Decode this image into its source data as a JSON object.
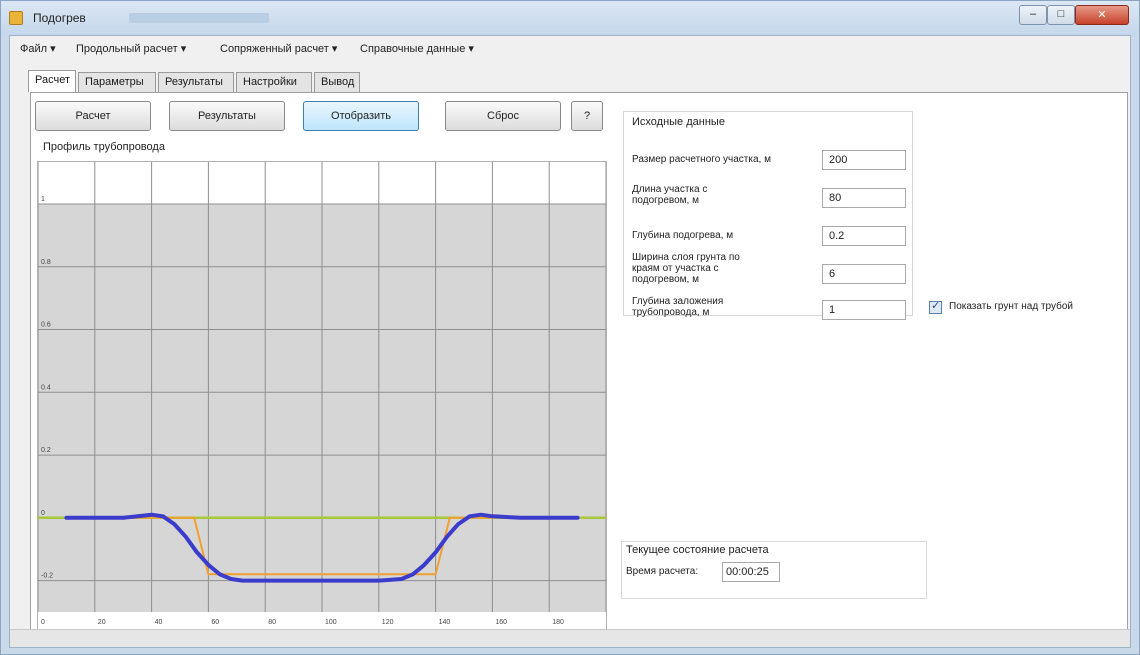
{
  "window": {
    "title": "Подогрев",
    "controls": {
      "minimize": "–",
      "maximize": "□",
      "close": "✕"
    }
  },
  "menu": [
    "Файл ▾",
    "Продольный расчет ▾",
    "Сопряженный расчет ▾",
    "Справочные данные ▾"
  ],
  "tabs": [
    "Расчет",
    "Параметры",
    "Результаты",
    "Настройки",
    "Вывод"
  ],
  "active_tab": 0,
  "toolbar": {
    "calc": "Расчет",
    "results": "Результаты",
    "show": "Отобразить",
    "reset": "Сброс",
    "help": "?"
  },
  "chart_title": "Профиль трубопровода",
  "input_group": {
    "title": "Исходные данные",
    "fields": [
      {
        "label": "Размер расчетного участка, м",
        "value": "200"
      },
      {
        "label": "Длина участка с подогревом, м",
        "value": "80"
      },
      {
        "label": "Глубина подогрева, м",
        "value": "0.2"
      },
      {
        "label": "Ширина слоя грунта по краям от участка с подогревом, м",
        "value": "6"
      },
      {
        "label": "Глубина заложения трубопровода, м",
        "value": "1"
      }
    ]
  },
  "checkbox": {
    "label": "Показать грунт над трубой",
    "checked": true
  },
  "state_group": {
    "title": "Текущее состояние расчета",
    "time_label": "Время расчета:",
    "time_value": "00:00:25"
  },
  "colors": {
    "plot_bg": "#d6d6d6",
    "grid": "#8f8f8f",
    "ground_line": "#a8c83a",
    "pipe_line": "#3c3ccc",
    "trench_line": "#f0a030"
  },
  "chart_data": {
    "type": "line",
    "x_ticks": [
      "0",
      "20",
      "40",
      "60",
      "80",
      "100",
      "120",
      "140",
      "160",
      "180"
    ],
    "y_ticks": [
      "1",
      "0.8",
      "0.6",
      "0.4",
      "0.2",
      "0",
      "-0.2"
    ],
    "xlim": [
      0,
      200
    ],
    "ylim": [
      -0.3,
      1.0
    ],
    "grid": true,
    "series": [
      {
        "key": "ground",
        "x": [
          0,
          200
        ],
        "y": [
          0,
          0
        ]
      },
      {
        "key": "trench",
        "x": [
          10,
          55,
          60,
          140,
          145,
          190
        ],
        "y": [
          0,
          0,
          -0.18,
          -0.18,
          0,
          0
        ]
      },
      {
        "key": "pipe",
        "x": [
          10,
          30,
          40,
          44,
          48,
          52,
          56,
          60,
          64,
          68,
          72,
          80,
          100,
          120,
          128,
          132,
          136,
          140,
          144,
          148,
          152,
          156,
          160,
          170,
          190
        ],
        "y": [
          0,
          0.0,
          0.01,
          0.005,
          -0.02,
          -0.06,
          -0.11,
          -0.15,
          -0.18,
          -0.195,
          -0.2,
          -0.2,
          -0.2,
          -0.2,
          -0.195,
          -0.18,
          -0.15,
          -0.11,
          -0.06,
          -0.02,
          0.005,
          0.01,
          0.005,
          0,
          0
        ]
      }
    ]
  }
}
